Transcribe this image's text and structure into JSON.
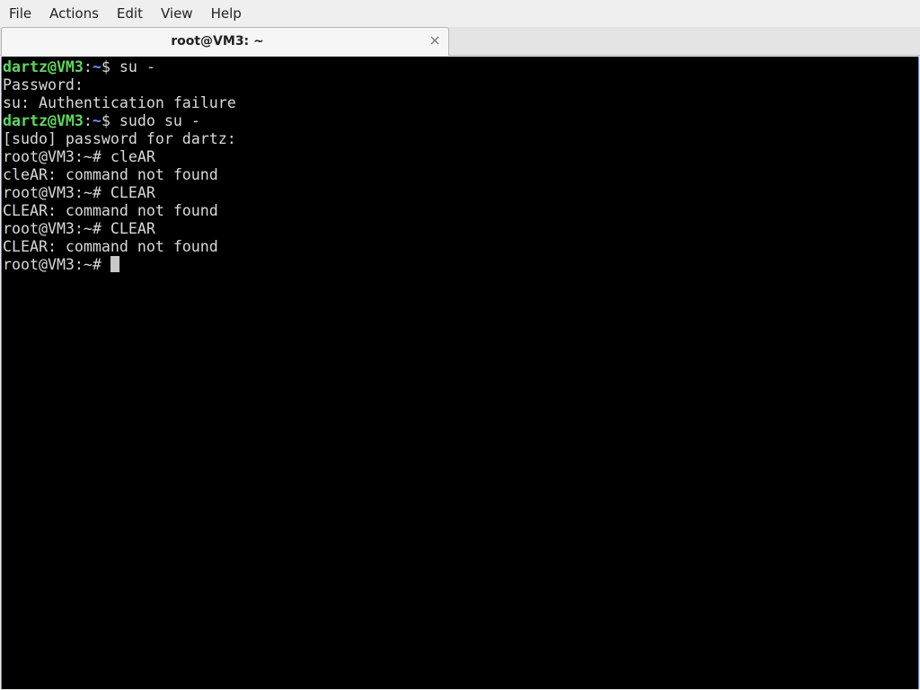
{
  "menubar": {
    "items": [
      "File",
      "Actions",
      "Edit",
      "View",
      "Help"
    ]
  },
  "tab": {
    "title": "root@VM3: ~",
    "close_icon": "close-icon"
  },
  "terminal": {
    "colors": {
      "background": "#000000",
      "text": "#d9d9d9",
      "user_host": "#5fd75f",
      "path": "#6f8fff"
    },
    "lines": [
      {
        "user": "dartz@VM3",
        "sep": ":",
        "path": "~",
        "prompt_end": "$ ",
        "text": "su -"
      },
      {
        "text": "Password:"
      },
      {
        "text": "su: Authentication failure"
      },
      {
        "user": "dartz@VM3",
        "sep": ":",
        "path": "~",
        "prompt_end": "$ ",
        "text": "sudo su -"
      },
      {
        "text": "[sudo] password for dartz:"
      },
      {
        "text": "root@VM3:~# cleAR"
      },
      {
        "text": "cleAR: command not found"
      },
      {
        "text": "root@VM3:~# CLEAR"
      },
      {
        "text": "CLEAR: command not found"
      },
      {
        "text": "root@VM3:~# CLEAR"
      },
      {
        "text": "CLEAR: command not found"
      },
      {
        "text": "root@VM3:~# "
      }
    ]
  }
}
